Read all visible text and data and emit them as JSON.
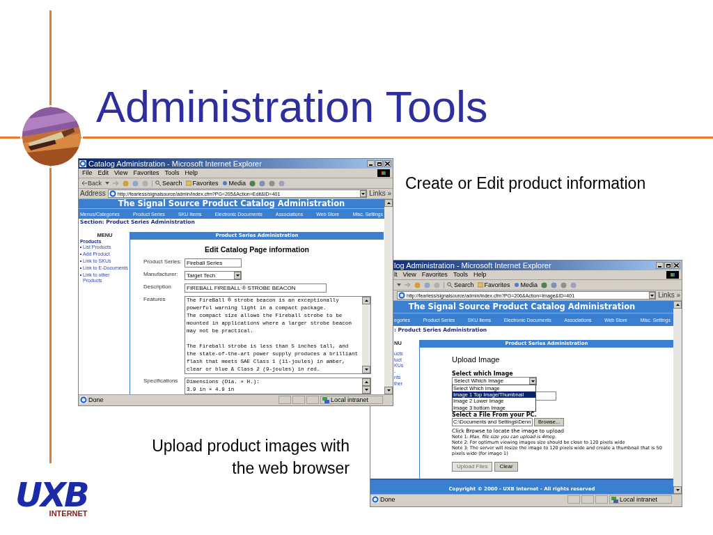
{
  "slide": {
    "title": "Administration Tools",
    "captions": [
      "Create or Edit product information",
      "Upload product images with the web browser"
    ],
    "logo": {
      "mark": "UXB",
      "tagline": "INTERNET"
    }
  },
  "edit_window": {
    "title": "Catalog Administration - Microsoft Internet Explorer",
    "menu": [
      "File",
      "Edit",
      "View",
      "Favorites",
      "Tools",
      "Help"
    ],
    "toolbar": [
      "Back",
      "Search",
      "Favorites",
      "Media"
    ],
    "address_label": "Address",
    "url": "http://fearless/signalsource/admin/index.cfm?PG=205&Action=Edit&ID=401",
    "links": "Links »",
    "site_title": "The Signal Source Product Catalog Administration",
    "nav": [
      "Menus/Categories",
      "Product Series",
      "SKU Items",
      "Electronic Documents",
      "Associations",
      "Web Store",
      "Misc. Settings"
    ],
    "section": "Section: Product Series Administration",
    "menu_heading": "MENU",
    "menu_group": "Products",
    "menu_links": [
      "List Products",
      "Add Product",
      "Link to SKUs",
      "Link to E-Documents",
      "Link to other Products"
    ],
    "panel_title": "Product Series Administration",
    "form_title": "Edit Catalog Page information",
    "fields": [
      {
        "kind": "text",
        "label": "Product Series:",
        "value": "Fireball Series"
      },
      {
        "kind": "select",
        "label": "Manufacturer:",
        "value": "Target Tech"
      },
      {
        "kind": "wide",
        "label": "Description",
        "value": "FIREBALL FIREBALL ® STROBE BEACON"
      },
      {
        "kind": "textarea",
        "label": "Features",
        "paragraphs": [
          [
            "The FireBall ® strobe beacon is an exceptionally",
            "powerful warning light in a compact package.",
            "The compact size allows the Fireball strobe to be",
            "mounted in applications where a larger strobe beacon",
            "may not be practical."
          ],
          [
            "The Fireball strobe is less than 5 inches tall, and",
            "the state-of-the-art power supply produces a brilliant",
            "flash that meets SAE Class 1 (11-joules) in amber,",
            "clear or blue & Class 2 (9-joules) in red."
          ]
        ]
      },
      {
        "kind": "textarea",
        "label": "Specifications",
        "paragraphs": [
          [
            "Dimensions (Dia. × H.):",
            "3.9 in × 4.9 in"
          ]
        ]
      }
    ],
    "status": "Done",
    "zone": "Local intranet"
  },
  "upload_window": {
    "title": "log Administration - Microsoft Internet Explorer",
    "menu": [
      "lt",
      "View",
      "Favorites",
      "Tools",
      "Help"
    ],
    "toolbar": [
      "Search",
      "Favorites",
      "Media"
    ],
    "url": "http://fearless/signalsource/admin/index.cfm?PG=206&Action=Image&ID=401",
    "links": "Links »",
    "site_title": "The Signal Source Product Catalog Administration",
    "nav": [
      "egories",
      "Product Series",
      "SKU Items",
      "Electronic Documents",
      "Associations",
      "Web Store",
      "Misc. Settings"
    ],
    "section": ": Product Series Administration",
    "menu_heading": "NU",
    "menu_links": [
      "ucts",
      "luct",
      "KUs",
      "-",
      "nts",
      "ther"
    ],
    "panel_title": "Product Series Administration",
    "form_title": "Upload Image",
    "select_label": "Select which Image",
    "select_value": "Select Which Image",
    "options": [
      {
        "label": "Select Which Image",
        "selected": false
      },
      {
        "label": "Image 1 Top Image/Thumbnail",
        "selected": true
      },
      {
        "label": "Image 2 Lower Image",
        "selected": false
      },
      {
        "label": "Image 3 bottom Image",
        "selected": false
      }
    ],
    "file_label": "Select a File From your PC.",
    "file_value": "C:\\Documents and Settings\\Denn",
    "browse": "Browse...",
    "hint": "Click Browse to locate the image to upload",
    "notes": [
      "Note 1: *Max. file size you can upload is 4meg.*",
      "Note 2: For optimum viewing images size should be close to 120 pixels wide",
      "Note 3: The server will resize the image to 120 pixels wide and create a thumbnail that is 50 pixels wide (for image 1)"
    ],
    "buttons": [
      {
        "label": "Upload Files",
        "disabled": true
      },
      {
        "label": "Clear",
        "disabled": false
      }
    ],
    "footer": "Copyright © 2000 - UXB Internet - All rights reserved",
    "status": "Done",
    "zone": "Local intranet"
  }
}
